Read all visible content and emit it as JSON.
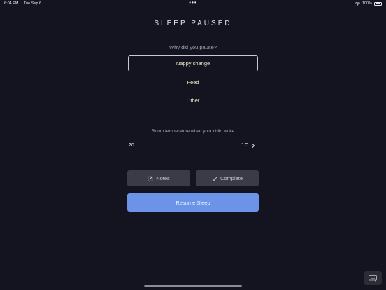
{
  "status_bar": {
    "time": "6:04 PM",
    "date": "Tue Sep 6",
    "dots": "•••",
    "battery": "100%"
  },
  "title": "SLEEP PAUSED",
  "question": "Why did you pause?",
  "options": [
    {
      "label": "Nappy change",
      "selected": true
    },
    {
      "label": "Feed",
      "selected": false
    },
    {
      "label": "Other",
      "selected": false
    }
  ],
  "temperature": {
    "label": "Room temperature when your child woke",
    "value": "20",
    "unit": "° C"
  },
  "buttons": {
    "notes": "Notes",
    "complete": "Complete",
    "resume": "Resume Sleep"
  },
  "colors": {
    "background": "#13141f",
    "accent": "#6b93e8",
    "option_text": "#f1e7cf",
    "secondary_button": "#3a3b47"
  }
}
